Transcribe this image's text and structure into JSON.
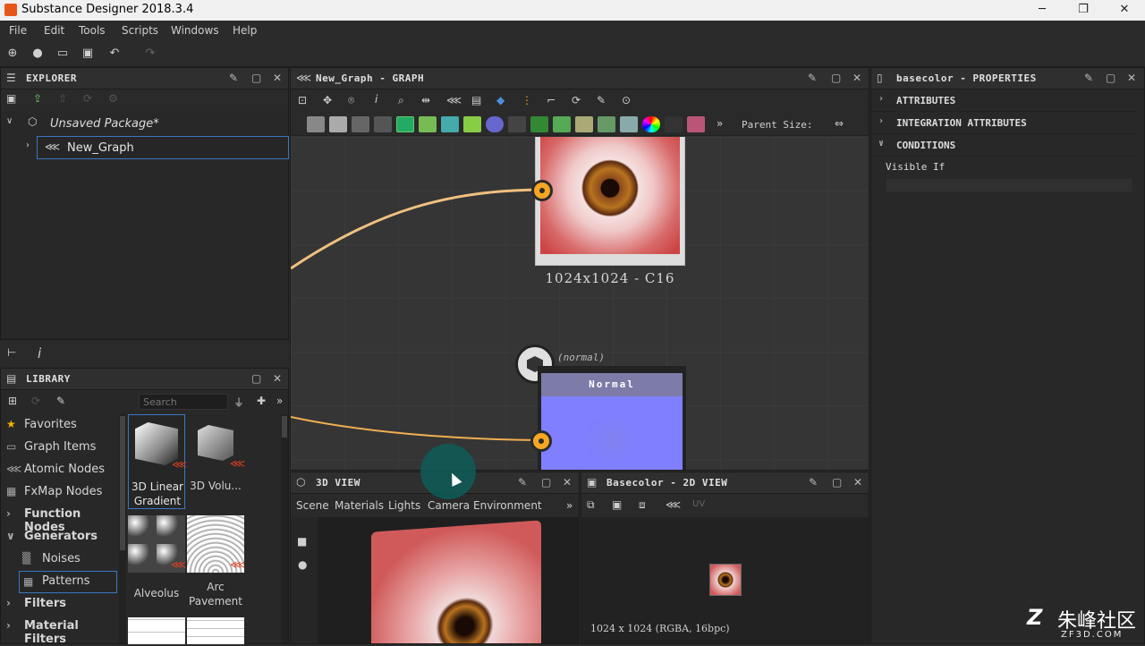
{
  "app": {
    "title": "Substance Designer 2018.3.4"
  },
  "window": {
    "minimize": "─",
    "restore": "❐",
    "close": "✕"
  },
  "menu": [
    "File",
    "Edit",
    "Tools",
    "Scripts",
    "Windows",
    "Help"
  ],
  "explorer": {
    "title": "EXPLORER",
    "package": "Unsaved Package*",
    "graph": "New_Graph"
  },
  "graph": {
    "title": "New_Graph - GRAPH",
    "parent_size": "Parent Size:",
    "node1": {
      "label": "1024x1024 - C16"
    },
    "node2": {
      "title": "Normal",
      "tag": "(normal)"
    }
  },
  "properties": {
    "title": "basecolor - PROPERTIES",
    "rows": [
      "ATTRIBUTES",
      "INTEGRATION ATTRIBUTES",
      "CONDITIONS"
    ],
    "visible_if": "Visible If"
  },
  "library": {
    "title": "LIBRARY",
    "search_placeholder": "Search",
    "categories": [
      "Favorites",
      "Graph Items",
      "Atomic Nodes",
      "FxMap Nodes",
      "Function Nodes",
      "Generators",
      "Noises",
      "Patterns",
      "Filters",
      "Material Filters"
    ],
    "items": [
      "3D Linear Gradient",
      "3D Volu...",
      "Alveolus",
      "Arc Pavement"
    ]
  },
  "view3d": {
    "title": "3D VIEW",
    "tabs": [
      "Scene",
      "Materials",
      "Lights",
      "Camera",
      "Environment"
    ]
  },
  "view2d": {
    "title": "Basecolor - 2D VIEW",
    "status": "1024 x 1024 (RGBA, 16bpc)",
    "uv": "UV"
  },
  "watermark": {
    "text": "朱峰社区",
    "sub": "ZF3D.COM"
  },
  "colors": {
    "accent": "#f5a623",
    "wire": "#f0c080",
    "normal": "#7f7fff",
    "teal": "#0d5c57"
  }
}
